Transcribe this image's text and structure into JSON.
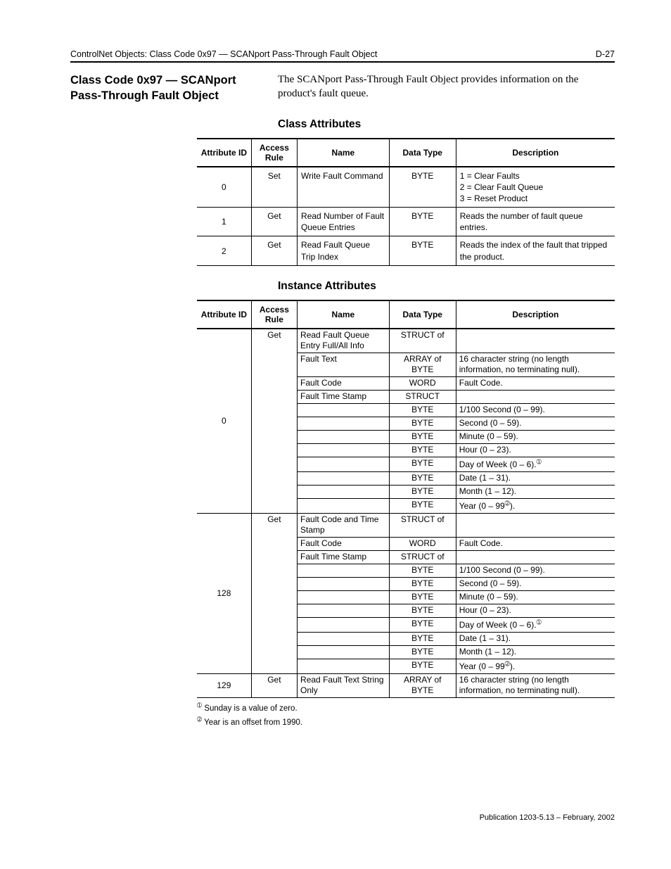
{
  "header": {
    "left": "ControlNet Objects: Class Code 0x97 — SCANport Pass-Through Fault Object",
    "right": "D-27"
  },
  "section_heading": "Class Code 0x97 — SCANport Pass-Through Fault Object",
  "intro": "The SCANport Pass-Through Fault Object provides information on the product's fault queue.",
  "class_attr_heading": "Class Attributes",
  "instance_attr_heading": "Instance Attributes",
  "cols": {
    "id": "Attribute ID",
    "rule": "Access Rule",
    "name": "Name",
    "type": "Data Type",
    "desc": "Description"
  },
  "class_rows": [
    {
      "id": "0",
      "rule": "Set",
      "name": "Write Fault Command",
      "type": "BYTE",
      "desc": "1 = Clear Faults\n2 = Clear Fault Queue\n3 = Reset Product"
    },
    {
      "id": "1",
      "rule": "Get",
      "name": "Read Number of Fault Queue Entries",
      "type": "BYTE",
      "desc": "Reads the number of fault queue entries."
    },
    {
      "id": "2",
      "rule": "Get",
      "name": "Read Fault Queue Trip Index",
      "type": "BYTE",
      "desc": "Reads the index of the fault that tripped the product."
    }
  ],
  "inst": {
    "g0": {
      "id": "0",
      "rule": "Get",
      "rows": [
        {
          "name": "Read Fault Queue Entry Full/All Info",
          "type": "STRUCT of",
          "desc": ""
        },
        {
          "name": "Fault Text",
          "type": "ARRAY of BYTE",
          "desc": "16 character string (no length information, no terminating null)."
        },
        {
          "name": "Fault Code",
          "type": "WORD",
          "desc": "Fault Code."
        },
        {
          "name": "Fault Time Stamp",
          "type": "STRUCT",
          "desc": ""
        },
        {
          "name": "",
          "type": "BYTE",
          "desc": "1/100 Second (0 – 99)."
        },
        {
          "name": "",
          "type": "BYTE",
          "desc": "Second (0 – 59)."
        },
        {
          "name": "",
          "type": "BYTE",
          "desc": "Minute (0 – 59)."
        },
        {
          "name": "",
          "type": "BYTE",
          "desc": "Hour (0 – 23)."
        },
        {
          "name": "",
          "type": "BYTE",
          "desc": "Day of Week (0 – 6).",
          "sup": "➀"
        },
        {
          "name": "",
          "type": "BYTE",
          "desc": "Date (1 – 31)."
        },
        {
          "name": "",
          "type": "BYTE",
          "desc": "Month (1 – 12)."
        },
        {
          "name": "",
          "type": "BYTE",
          "desc": "Year (0 – 99",
          "sup": "➁",
          "tail": ")."
        }
      ]
    },
    "g128": {
      "id": "128",
      "rule": "Get",
      "rows": [
        {
          "name": "Fault Code and Time Stamp",
          "type": "STRUCT of",
          "desc": ""
        },
        {
          "name": "Fault Code",
          "type": "WORD",
          "desc": "Fault Code."
        },
        {
          "name": "Fault Time Stamp",
          "type": "STRUCT of",
          "desc": ""
        },
        {
          "name": "",
          "type": "BYTE",
          "desc": "1/100 Second (0 – 99)."
        },
        {
          "name": "",
          "type": "BYTE",
          "desc": "Second (0 – 59)."
        },
        {
          "name": "",
          "type": "BYTE",
          "desc": "Minute (0 – 59)."
        },
        {
          "name": "",
          "type": "BYTE",
          "desc": "Hour (0 – 23)."
        },
        {
          "name": "",
          "type": "BYTE",
          "desc": "Day of Week (0 – 6).",
          "sup": "➀"
        },
        {
          "name": "",
          "type": "BYTE",
          "desc": "Date (1 – 31)."
        },
        {
          "name": "",
          "type": "BYTE",
          "desc": "Month (1 – 12)."
        },
        {
          "name": "",
          "type": "BYTE",
          "desc": "Year (0 – 99",
          "sup": "➁",
          "tail": ")."
        }
      ]
    },
    "g129": {
      "id": "129",
      "rule": "Get",
      "name": "Read Fault Text String Only",
      "type": "ARRAY of BYTE",
      "desc": "16 character string (no length information, no terminating null)."
    }
  },
  "footnotes": {
    "f1_mark": "➀",
    "f1": " Sunday is a value of zero.",
    "f2_mark": "➁",
    "f2": " Year is an offset from 1990."
  },
  "publication": "Publication 1203-5.13 – February, 2002"
}
